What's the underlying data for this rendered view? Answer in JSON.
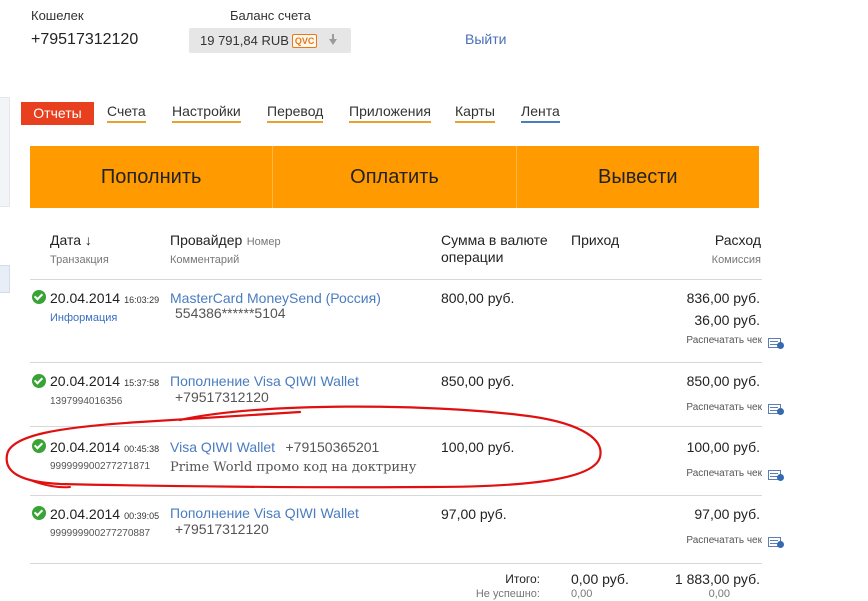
{
  "header": {
    "wallet_label": "Кошелек",
    "wallet_number": "+79517312120",
    "balance_label": "Баланс счета",
    "balance_value": "19 791,84 RUB",
    "balance_badge": "QVC",
    "logout": "Выйти"
  },
  "tabs": [
    {
      "label": "Отчеты",
      "active": true
    },
    {
      "label": "Счета",
      "underline": "#e8a030"
    },
    {
      "label": "Настройки",
      "underline": "#e8a030"
    },
    {
      "label": "Перевод",
      "underline": "#e8a030"
    },
    {
      "label": "Приложения",
      "underline": "#e8a030"
    },
    {
      "label": "Карты",
      "underline": "#e8a030"
    },
    {
      "label": "Лента",
      "underline": "#4a7cc0"
    }
  ],
  "actions": [
    "Пополнить",
    "Оплатить",
    "Вывести"
  ],
  "table": {
    "columns": {
      "date": "Дата ↓",
      "date_sub": "Транзакция",
      "provider": "Провайдер",
      "provider_number": "Номер",
      "provider_sub": "Комментарий",
      "amount": "Сумма в валюте операции",
      "income": "Приход",
      "expense": "Расход",
      "expense_sub": "Комиссия"
    },
    "rows": [
      {
        "date": "20.04.2014",
        "time": "16:03:29",
        "tx": "Информация",
        "provider": "MasterCard MoneySend (Россия)",
        "number": "",
        "comment": "554386******5104",
        "amount": "800,00 руб.",
        "income": "",
        "expense": "836,00 руб.",
        "commission": "36,00 руб.",
        "print": "Распечатать чек"
      },
      {
        "date": "20.04.2014",
        "time": "15:37:58",
        "tx": "1397994016356",
        "provider": "Пополнение Visa QIWI Wallet",
        "number": "",
        "comment": "+79517312120",
        "amount": "850,00 руб.",
        "income": "",
        "expense": "850,00 руб.",
        "commission": "",
        "print": "Распечатать чек"
      },
      {
        "date": "20.04.2014",
        "time": "00:45:38",
        "tx": "999999900277271871",
        "provider": "Visa QIWI Wallet",
        "number": "+79150365201",
        "comment": "Prime World промо код на доктрину",
        "amount": "100,00 руб.",
        "income": "",
        "expense": "100,00 руб.",
        "commission": "",
        "print": "Распечатать чек"
      },
      {
        "date": "20.04.2014",
        "time": "00:39:05",
        "tx": "999999900277270887",
        "provider": "Пополнение Visa QIWI Wallet",
        "number": "",
        "comment": "+79517312120",
        "amount": "97,00 руб.",
        "income": "",
        "expense": "97,00 руб.",
        "commission": "",
        "print": "Распечатать чек"
      }
    ],
    "totals": {
      "label": "Итого:",
      "failed_label": "Не успешно:",
      "income": "0,00 руб.",
      "expense": "1 883,00 руб.",
      "failed_income": "0,00",
      "failed_expense": "0,00"
    }
  },
  "colors": {
    "active_tab": "#e8401f",
    "action_bar": "#ff9a00",
    "link": "#4a7cc0",
    "success": "#3aa335",
    "annotation": "#e01010"
  }
}
